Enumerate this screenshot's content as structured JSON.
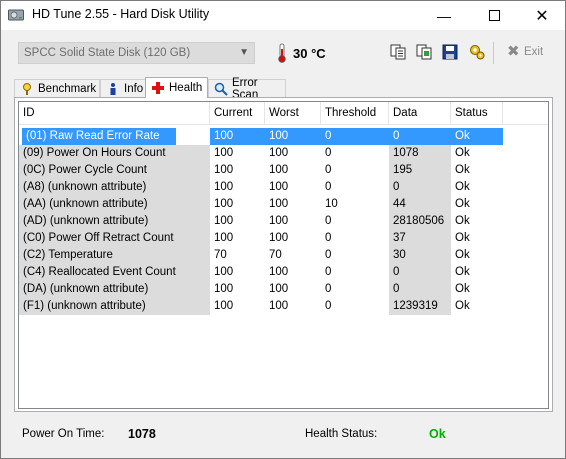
{
  "window": {
    "title": "HD Tune 2.55 - Hard Disk Utility",
    "minimize_glyph": "—",
    "close_glyph": "✕"
  },
  "toolbar": {
    "drive": "SPCC    Solid State Disk (120 GB)",
    "temperature": "30 °C",
    "icons": [
      "copy-info-icon",
      "copy-screenshot-icon",
      "save-icon",
      "options-icon"
    ],
    "exit_label": "Exit"
  },
  "tabs": [
    {
      "label": "Benchmark",
      "icon": "benchmark-icon"
    },
    {
      "label": "Info",
      "icon": "info-icon"
    },
    {
      "label": "Health",
      "icon": "health-icon",
      "active": true
    },
    {
      "label": "Error Scan",
      "icon": "error-scan-icon"
    }
  ],
  "table": {
    "columns": [
      "ID",
      "Current",
      "Worst",
      "Threshold",
      "Data",
      "Status"
    ],
    "rows": [
      {
        "id": "(01) Raw Read Error Rate",
        "current": "100",
        "worst": "100",
        "threshold": "0",
        "data": "0",
        "status": "Ok",
        "selected": true
      },
      {
        "id": "(09) Power On Hours Count",
        "current": "100",
        "worst": "100",
        "threshold": "0",
        "data": "1078",
        "status": "Ok"
      },
      {
        "id": "(0C) Power Cycle Count",
        "current": "100",
        "worst": "100",
        "threshold": "0",
        "data": "195",
        "status": "Ok"
      },
      {
        "id": "(A8) (unknown attribute)",
        "current": "100",
        "worst": "100",
        "threshold": "0",
        "data": "0",
        "status": "Ok"
      },
      {
        "id": "(AA) (unknown attribute)",
        "current": "100",
        "worst": "100",
        "threshold": "10",
        "data": "44",
        "status": "Ok"
      },
      {
        "id": "(AD) (unknown attribute)",
        "current": "100",
        "worst": "100",
        "threshold": "0",
        "data": "28180506",
        "status": "Ok"
      },
      {
        "id": "(C0) Power Off Retract Count",
        "current": "100",
        "worst": "100",
        "threshold": "0",
        "data": "37",
        "status": "Ok"
      },
      {
        "id": "(C2) Temperature",
        "current": "70",
        "worst": "70",
        "threshold": "0",
        "data": "30",
        "status": "Ok"
      },
      {
        "id": "(C4) Reallocated Event Count",
        "current": "100",
        "worst": "100",
        "threshold": "0",
        "data": "0",
        "status": "Ok"
      },
      {
        "id": "(DA) (unknown attribute)",
        "current": "100",
        "worst": "100",
        "threshold": "0",
        "data": "0",
        "status": "Ok"
      },
      {
        "id": "(F1) (unknown attribute)",
        "current": "100",
        "worst": "100",
        "threshold": "0",
        "data": "1239319",
        "status": "Ok"
      }
    ]
  },
  "footer": {
    "power_on_label": "Power On Time:",
    "power_on_value": "1078",
    "health_label": "Health Status:",
    "health_value": "Ok",
    "health_color": "#00b000"
  },
  "colors": {
    "selection": "#3399ff",
    "temperature_icon": "#d01010"
  }
}
